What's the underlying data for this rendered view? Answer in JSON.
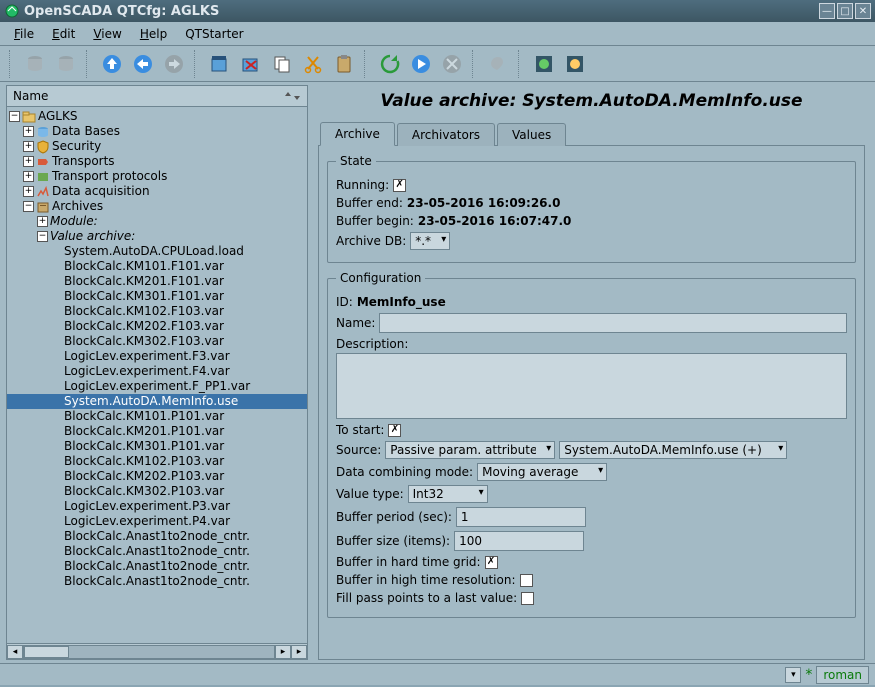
{
  "window": {
    "title": "OpenSCADA QTCfg: AGLKS"
  },
  "menu": {
    "file": "File",
    "edit": "Edit",
    "view": "View",
    "help": "Help",
    "qtstarter": "QTStarter"
  },
  "tree": {
    "header": "Name",
    "root": "AGLKS",
    "groups": {
      "databases": "Data Bases",
      "security": "Security",
      "transports": "Transports",
      "transport_protocols": "Transport protocols",
      "data_acquisition": "Data acquisition",
      "archives": "Archives"
    },
    "module_label": "Module:",
    "value_archive_label": "Value archive:",
    "items": [
      "System.AutoDA.CPULoad.load",
      "BlockCalc.KM101.F101.var",
      "BlockCalc.KM201.F101.var",
      "BlockCalc.KM301.F101.var",
      "BlockCalc.KM102.F103.var",
      "BlockCalc.KM202.F103.var",
      "BlockCalc.KM302.F103.var",
      "LogicLev.experiment.F3.var",
      "LogicLev.experiment.F4.var",
      "LogicLev.experiment.F_PP1.var",
      "System.AutoDA.MemInfo.use",
      "BlockCalc.KM101.P101.var",
      "BlockCalc.KM201.P101.var",
      "BlockCalc.KM301.P101.var",
      "BlockCalc.KM102.P103.var",
      "BlockCalc.KM202.P103.var",
      "BlockCalc.KM302.P103.var",
      "LogicLev.experiment.P3.var",
      "LogicLev.experiment.P4.var",
      "BlockCalc.Anast1to2node_cntr.",
      "BlockCalc.Anast1to2node_cntr.",
      "BlockCalc.Anast1to2node_cntr.",
      "BlockCalc.Anast1to2node_cntr."
    ],
    "selected_index": 10
  },
  "page": {
    "title": "Value archive: System.AutoDA.MemInfo.use",
    "tabs": {
      "archive": "Archive",
      "archivators": "Archivators",
      "values": "Values"
    }
  },
  "state": {
    "legend": "State",
    "running_label": "Running:",
    "running": true,
    "buffer_end_label": "Buffer end:",
    "buffer_end": "23-05-2016 16:09:26.0",
    "buffer_begin_label": "Buffer begin:",
    "buffer_begin": "23-05-2016 16:07:47.0",
    "archive_db_label": "Archive DB:",
    "archive_db": "*.*"
  },
  "config": {
    "legend": "Configuration",
    "id_label": "ID:",
    "id": "MemInfo_use",
    "name_label": "Name:",
    "name": "",
    "description_label": "Description:",
    "description": "",
    "to_start_label": "To start:",
    "to_start": true,
    "source_label": "Source:",
    "source_mode": "Passive param. attribute",
    "source_path": "System.AutoDA.MemInfo.use (+)",
    "combining_label": "Data combining mode:",
    "combining": "Moving average",
    "value_type_label": "Value type:",
    "value_type": "Int32",
    "buf_period_label": "Buffer period (sec):",
    "buf_period": "1",
    "buf_size_label": "Buffer size (items):",
    "buf_size": "100",
    "hard_grid_label": "Buffer in hard time grid:",
    "hard_grid": true,
    "high_res_label": "Buffer in high time resolution:",
    "high_res": false,
    "fill_pass_label": "Fill pass points to a last value:",
    "fill_pass": false
  },
  "status": {
    "user": "roman"
  }
}
